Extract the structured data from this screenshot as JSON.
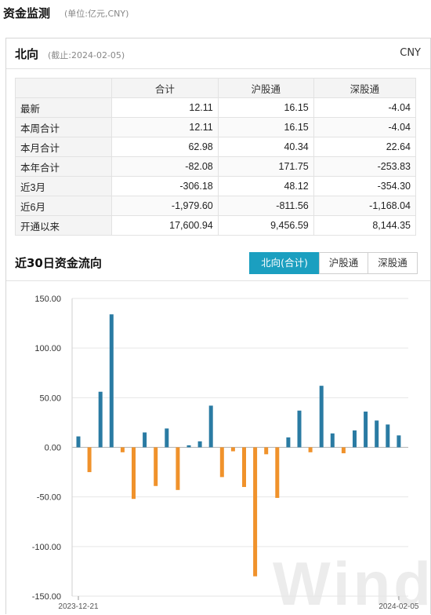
{
  "header": {
    "title": "资金监测",
    "subtitle": "(单位:亿元,CNY)"
  },
  "panel": {
    "title": "北向",
    "date": "(截止:2024-02-05)",
    "currency": "CNY"
  },
  "table": {
    "columns": [
      "合计",
      "沪股通",
      "深股通"
    ],
    "rows": [
      {
        "label": "最新",
        "values": [
          "12.11",
          "16.15",
          "-4.04"
        ]
      },
      {
        "label": "本周合计",
        "values": [
          "12.11",
          "16.15",
          "-4.04"
        ]
      },
      {
        "label": "本月合计",
        "values": [
          "62.98",
          "40.34",
          "22.64"
        ]
      },
      {
        "label": "本年合计",
        "values": [
          "-82.08",
          "171.75",
          "-253.83"
        ]
      },
      {
        "label": "近3月",
        "values": [
          "-306.18",
          "48.12",
          "-354.30"
        ]
      },
      {
        "label": "近6月",
        "values": [
          "-1,979.60",
          "-811.56",
          "-1,168.04"
        ]
      },
      {
        "label": "开通以来",
        "values": [
          "17,600.94",
          "9,456.59",
          "8,144.35"
        ]
      }
    ]
  },
  "section": {
    "title": "近30日资金流向"
  },
  "tabs": [
    {
      "label": "北向(合计)",
      "active": true
    },
    {
      "label": "沪股通",
      "active": false
    },
    {
      "label": "深股通",
      "active": false
    }
  ],
  "watermark": "Wind",
  "colors": {
    "positive": "#2a7ba3",
    "negative": "#f0922b",
    "tab_active": "#1b9fc0"
  },
  "chart_data": {
    "type": "bar",
    "ylim": [
      -150,
      150
    ],
    "yticks": [
      "150.00",
      "100.00",
      "50.00",
      "0.00",
      "-50.00",
      "-100.00",
      "-150.00"
    ],
    "ytick_values": [
      150,
      100,
      50,
      0,
      -50,
      -100,
      -150
    ],
    "xtick_labels": [
      "2023-12-21",
      "2024-02-05"
    ],
    "grid": true,
    "values": [
      11,
      -25,
      56,
      134,
      -5,
      -52,
      15,
      -39,
      19,
      -43,
      2,
      6,
      42,
      -30,
      -4,
      -40,
      -130,
      -7,
      -51,
      10,
      37,
      -5,
      62,
      14,
      -6,
      17,
      36,
      27,
      23,
      12
    ]
  }
}
